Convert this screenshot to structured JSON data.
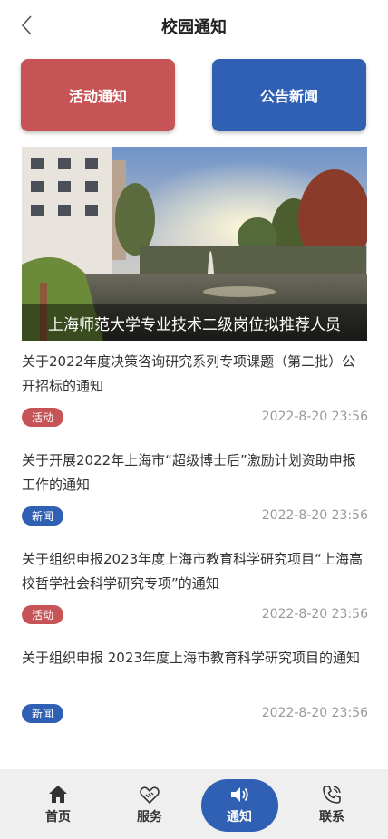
{
  "header": {
    "title": "校园通知",
    "back_icon": "chevron-left-icon"
  },
  "categories": [
    {
      "label": "活动通知",
      "color": "#c65456"
    },
    {
      "label": "公告新闻",
      "color": "#3060b4"
    }
  ],
  "banner": {
    "caption": "上海师范大学专业技术二级岗位拟推荐人员"
  },
  "news": [
    {
      "title": "关于2022年度决策咨询研究系列专项课题（第二批）公开招标的通知",
      "tag": "活动",
      "time": "2022-8-20 23:56"
    },
    {
      "title": "关于开展2022年上海市“超级博士后”激励计划资助申报工作的通知",
      "tag": "新闻",
      "time": "2022-8-20 23:56"
    },
    {
      "title": "关于组织申报2023年度上海市教育科学研究项目“上海高校哲学社会科学研究专项”的通知",
      "tag": "活动",
      "time": "2022-8-20 23:56"
    },
    {
      "title": "关于组织申报 2023年度上海市教育科学研究项目的通知",
      "tag": "新闻",
      "time": "2022-8-20 23:56"
    }
  ],
  "tabbar": {
    "items": [
      {
        "label": "首页",
        "icon": "home-icon"
      },
      {
        "label": "服务",
        "icon": "handshake-icon"
      },
      {
        "label": "通知",
        "icon": "speaker-icon"
      },
      {
        "label": "联系",
        "icon": "phone-icon"
      }
    ],
    "active": "通知",
    "accent": "#3060b4"
  }
}
